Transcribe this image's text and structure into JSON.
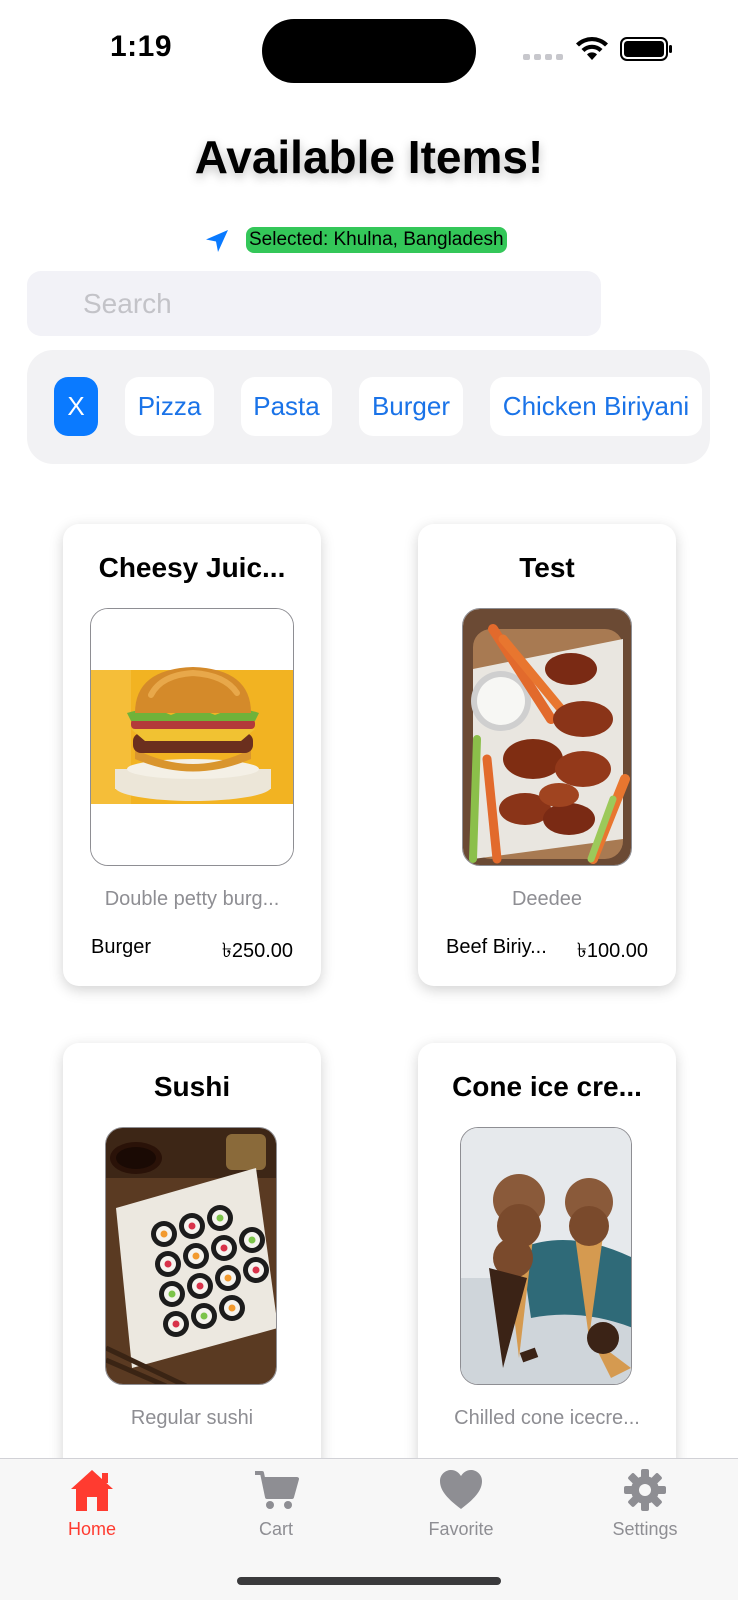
{
  "status_bar": {
    "time": "1:19"
  },
  "header": {
    "title": "Available Items!",
    "location_label": "Selected: Khulna, Bangladesh"
  },
  "search": {
    "placeholder": "Search",
    "value": ""
  },
  "categories": {
    "clear_label": "X",
    "items": [
      "Pizza",
      "Pasta",
      "Burger",
      "Chicken Biriyani"
    ]
  },
  "items": [
    {
      "title": "Cheesy Juic...",
      "description": "Double petty burg...",
      "category": "Burger",
      "price": "৳250.00",
      "image": "burger-image"
    },
    {
      "title": "Test",
      "description": "Deedee",
      "category": "Beef Biriy...",
      "price": "৳100.00",
      "image": "chicken-wings-image"
    },
    {
      "title": "Sushi",
      "description": "Regular sushi",
      "category": "",
      "price": "",
      "image": "sushi-image"
    },
    {
      "title": "Cone ice cre...",
      "description": "Chilled cone icecre...",
      "category": "",
      "price": "",
      "image": "ice-cream-image"
    }
  ],
  "tab_bar": {
    "tabs": [
      {
        "label": "Home",
        "icon": "house-icon",
        "active": true
      },
      {
        "label": "Cart",
        "icon": "cart-icon",
        "active": false
      },
      {
        "label": "Favorite",
        "icon": "heart-icon",
        "active": false
      },
      {
        "label": "Settings",
        "icon": "gear-icon",
        "active": false
      }
    ]
  },
  "colors": {
    "accent_blue": "#0a7aff",
    "location_green": "#34c759",
    "active_tab_red": "#ff3b30",
    "inactive_gray": "#8e8e93"
  }
}
